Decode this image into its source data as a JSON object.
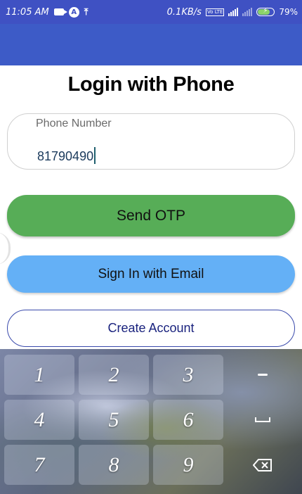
{
  "status_bar": {
    "time": "11:05 AM",
    "network_speed": "0.1KB/s",
    "battery_percent": "79%",
    "vo_label": "Vo LTE",
    "bolt": "⚡",
    "icons": [
      "video-camera-icon",
      "a-circle-icon",
      "upload-icon",
      "signal-icon",
      "signal-dim-icon",
      "battery-charging-icon"
    ]
  },
  "login": {
    "title": "Login with Phone",
    "phone_label": "Phone Number",
    "phone_value": "81790490",
    "send_otp_label": "Send OTP",
    "email_signin_label": "Sign In with Email",
    "create_account_label": "Create Account"
  },
  "colors": {
    "status_bar": "#3f51c3",
    "app_bar": "#3d5bc7",
    "send_otp_button": "#57ad57",
    "email_button": "#64b0f6",
    "create_account_border": "#3949ab"
  },
  "keyboard": {
    "keys": [
      "1",
      "2",
      "3",
      "4",
      "5",
      "6",
      "7",
      "8",
      "9"
    ],
    "side_keys": [
      "dash-icon",
      "space-icon",
      "backspace-icon"
    ]
  }
}
